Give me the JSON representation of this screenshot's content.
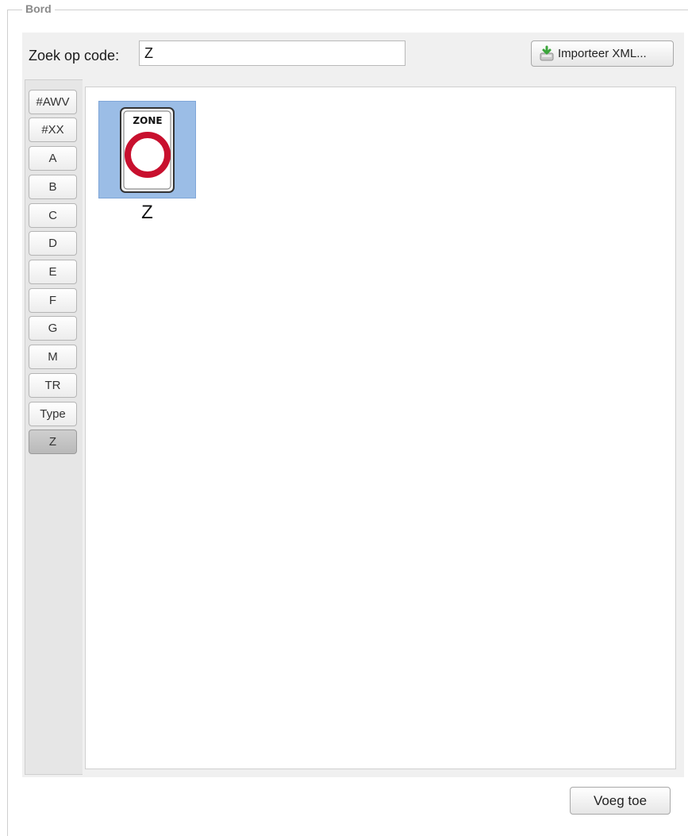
{
  "fieldset": {
    "legend": "Bord"
  },
  "search": {
    "label": "Zoek op code:",
    "value": "Z",
    "placeholder": ""
  },
  "toolbar": {
    "import_label": "Importeer XML..."
  },
  "tabs": [
    {
      "label": "#AWV",
      "active": false
    },
    {
      "label": "#XX",
      "active": false
    },
    {
      "label": "A",
      "active": false
    },
    {
      "label": "B",
      "active": false
    },
    {
      "label": "C",
      "active": false
    },
    {
      "label": "D",
      "active": false
    },
    {
      "label": "E",
      "active": false
    },
    {
      "label": "F",
      "active": false
    },
    {
      "label": "G",
      "active": false
    },
    {
      "label": "M",
      "active": false
    },
    {
      "label": "TR",
      "active": false
    },
    {
      "label": "Type",
      "active": false
    },
    {
      "label": "Z",
      "active": true
    }
  ],
  "signs": [
    {
      "code": "Z",
      "image_text": "ZONE",
      "selected": true
    }
  ],
  "footer": {
    "add_label": "Voeg toe"
  },
  "colors": {
    "selection": "#9bbde6",
    "sign_ring": "#c8102e",
    "panel_bg": "#f0f0f0"
  }
}
